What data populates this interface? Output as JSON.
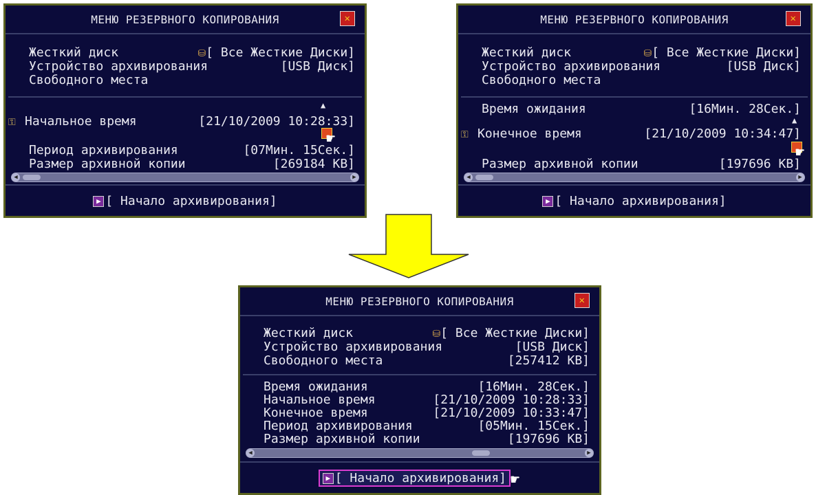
{
  "title": "МЕНЮ РЕЗЕРВНОГО КОПИРОВАНИЯ",
  "close_icon": "close-icon",
  "hdd_label": "Жесткий диск",
  "hdd_value": "[ Все Жесткие Диски]",
  "device_label": "Устройство архивирования",
  "device_value": "[USB Диск]",
  "free_label": "Свободного места",
  "start_button": "[ Начало архивирования]",
  "panel1": {
    "start_time_label": "Начальное время",
    "start_time_value": "[21/10/2009 10:28:33]",
    "period_label": "Период архивирования",
    "period_value": "[07Мин. 15Сек.]",
    "size_label": "Размер архивной копии",
    "size_value": "[269184 KB]"
  },
  "panel2": {
    "wait_label": "Время ожидания",
    "wait_value": "[16Мин. 28Сек.]",
    "end_time_label": "Конечное время",
    "end_time_value": "[21/10/2009 10:34:47]",
    "size_label": "Размер архивной копии",
    "size_value": "[197696 KB]"
  },
  "panel3": {
    "free_value": "[257412 KB]",
    "wait_label": "Время ожидания",
    "wait_value": "[16Мин. 28Сек.]",
    "start_time_label": "Начальное время",
    "start_time_value": "[21/10/2009 10:28:33]",
    "end_time_label": "Конечное время",
    "end_time_value": "[21/10/2009 10:33:47]",
    "period_label": "Период архивирования",
    "period_value": "[05Мин. 15Сек.]",
    "size_label": "Размер архивной копии",
    "size_value": "[197696 KB]"
  },
  "colors": {
    "panel_bg": "#0b0b3a",
    "panel_border": "#5c6420",
    "arrow_fill": "#ffff00",
    "highlight": "#d93cd0"
  }
}
